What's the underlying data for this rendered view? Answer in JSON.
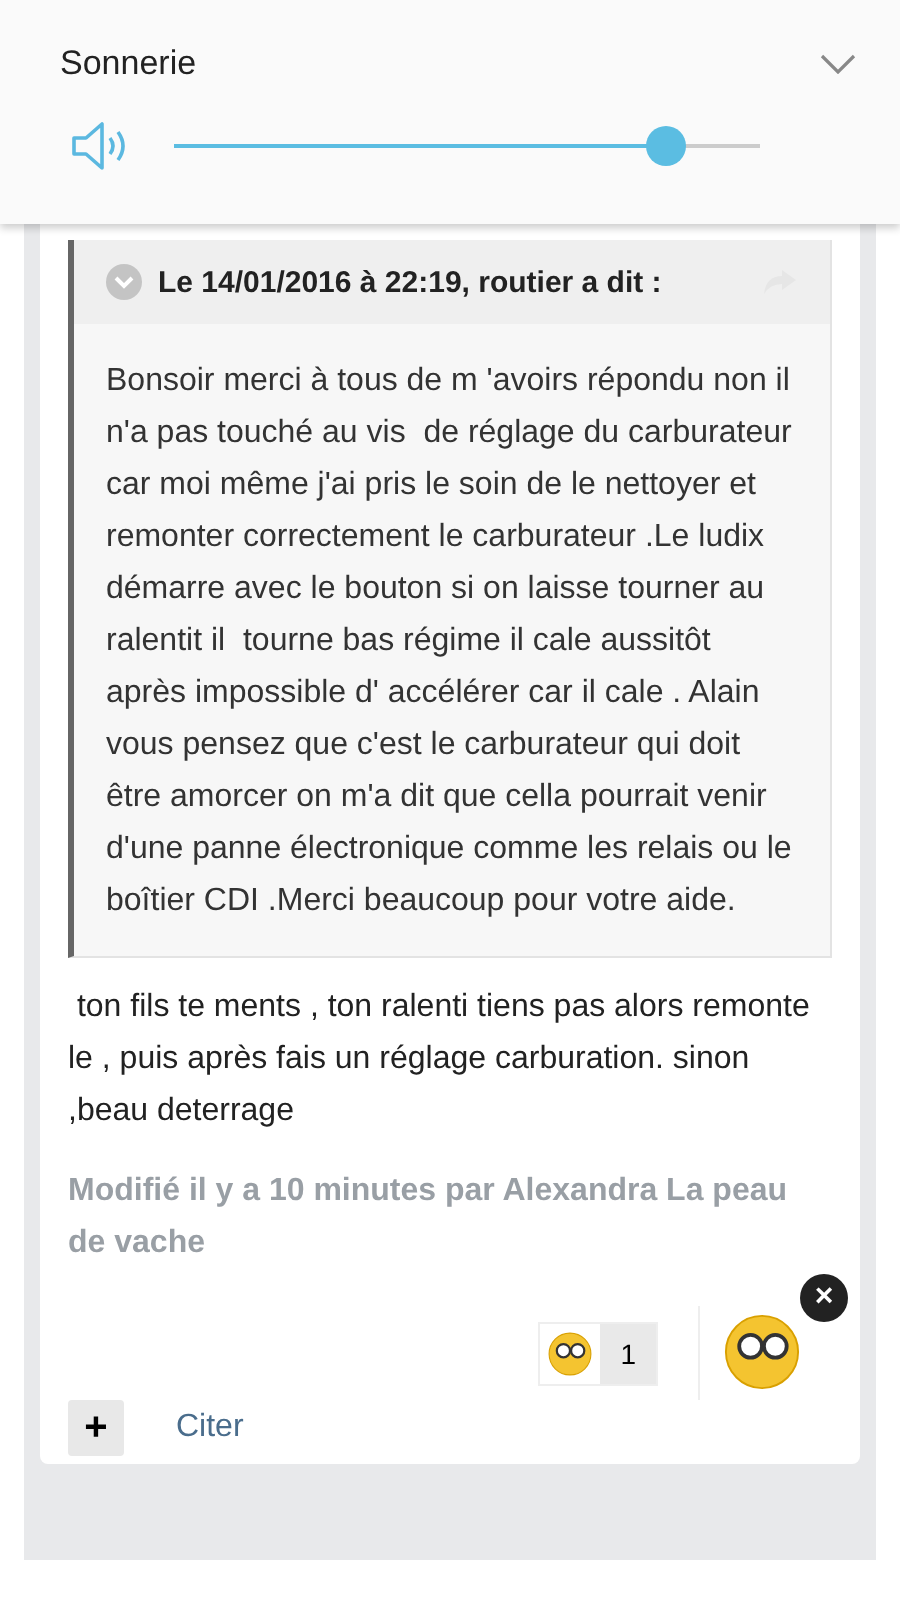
{
  "volume_panel": {
    "title": "Sonnerie",
    "expanded": false,
    "level": 0.84
  },
  "quote": {
    "header": "Le 14/01/2016 à 22:19, routier a dit :",
    "expanded": true,
    "text": "Bonsoir merci à tous de m 'avoirs répondu non il n'a pas touché au vis  de réglage du carburateur car moi même j'ai pris le soin de le nettoyer et remonter correctement le carburateur .Le ludix démarre avec le bouton si on laisse tourner au ralentit il  tourne bas régime il cale aussitôt après impossible d' accélérer car il cale . Alain vous pensez que c'est le carburateur qui doit être amorcer on m'a dit que cella pourrait venir d'une panne électronique comme les relais ou le boîtier CDI .Merci beaucoup pour votre aide."
  },
  "post": {
    "text": " ton fils te ments , ton ralenti tiens pas alors remonte le , puis après fais un réglage carburation. sinon ,beau deterrage",
    "edited": "Modifié il y a 10 minutes par Alexandra La peau de vache"
  },
  "reaction": {
    "count": "1",
    "close": "×"
  },
  "actions": {
    "add": "+",
    "quote": "Citer"
  }
}
